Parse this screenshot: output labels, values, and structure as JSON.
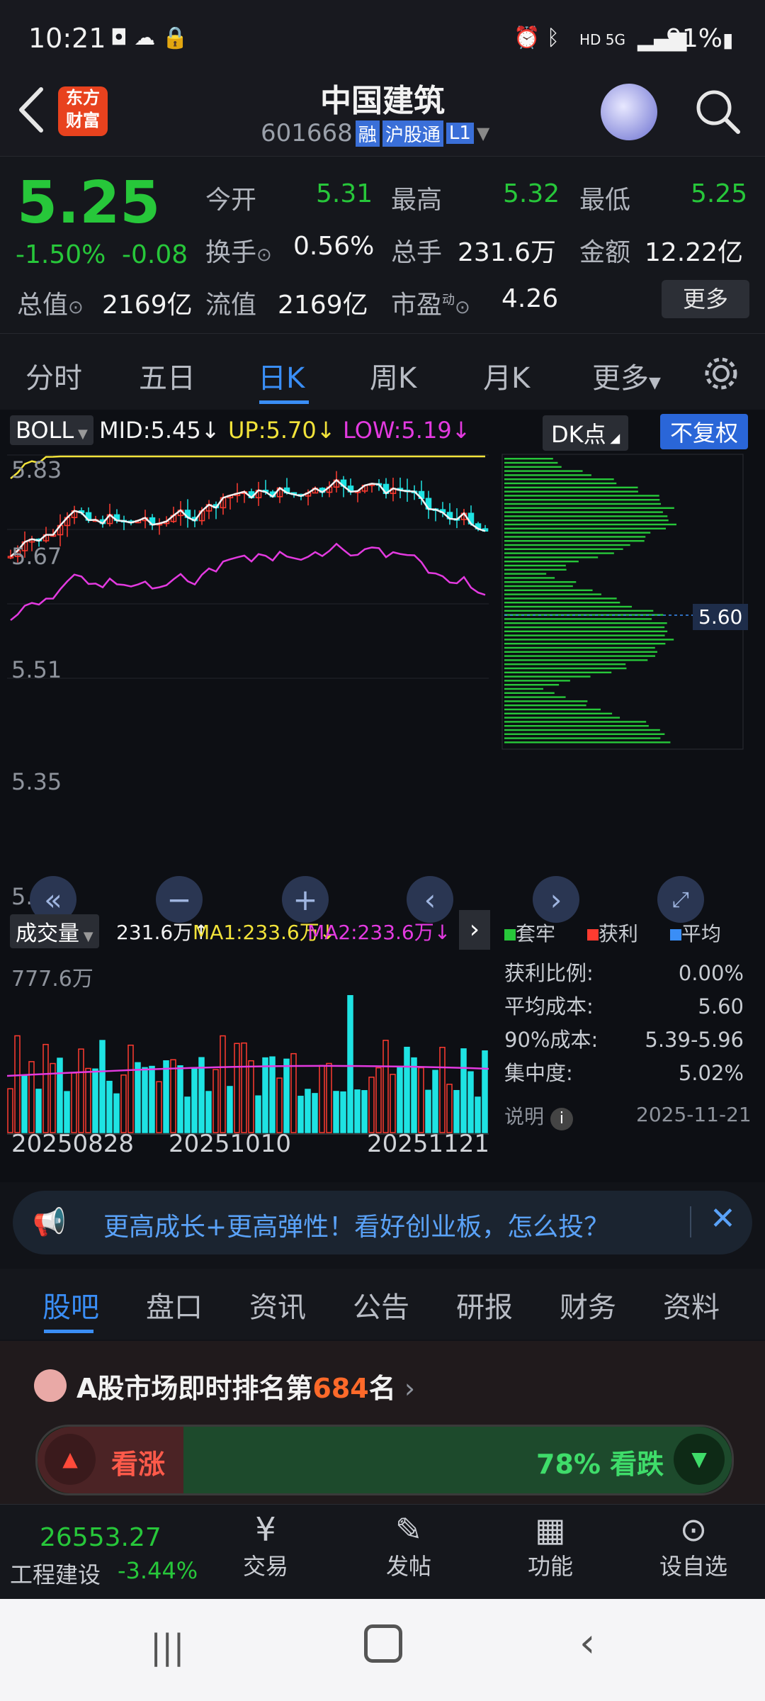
{
  "status": {
    "time": "10:21",
    "battery": "91%",
    "network": "HD 5G"
  },
  "header": {
    "app_logo_line1": "东方",
    "app_logo_line2": "财富",
    "stock_name": "中国建筑",
    "stock_code": "601668",
    "tag_margin": "融",
    "tag_connect": "沪股通",
    "tag_level": "L1"
  },
  "quote": {
    "price": "5.25",
    "change_pct": "-1.50%",
    "change": "-0.08",
    "open_label": "今开",
    "open": "5.31",
    "high_label": "最高",
    "high": "5.32",
    "low_label": "最低",
    "low": "5.25",
    "turnover_label": "换手",
    "turnover": "0.56%",
    "volume_label": "总手",
    "volume": "231.6万",
    "amount_label": "金额",
    "amount": "12.22亿",
    "mcap_label": "总值",
    "mcap": "2169亿",
    "float_label": "流值",
    "float": "2169亿",
    "pe_label": "市盈",
    "pe_sup": "动",
    "pe": "4.26",
    "more": "更多"
  },
  "tabs": [
    "分时",
    "五日",
    "日K",
    "周K",
    "月K",
    "更多"
  ],
  "indicator": {
    "name": "BOLL",
    "mid": "MID:5.45↓",
    "up": "UP:5.70↓",
    "low": "LOW:5.19↓",
    "dk": "DK点",
    "adjust": "不复权"
  },
  "chart_axis": {
    "y1": "5.83",
    "y2": "5.67",
    "y3": "5.51",
    "y4": "5.35",
    "y5": "5.19"
  },
  "volume": {
    "name": "成交量",
    "val": "231.6万↑",
    "ma1": "MA1:233.6万↓",
    "ma2": "MA2:233.6万↓",
    "max": "777.6万"
  },
  "dates": [
    "20250828",
    "20251010",
    "20251121"
  ],
  "chip": {
    "avg_label": "5.60",
    "legend": [
      "套牢",
      "获利",
      "平均"
    ],
    "rows": [
      {
        "k": "获利比例:",
        "v": "0.00%"
      },
      {
        "k": "平均成本:",
        "v": "5.60"
      },
      {
        "k": "90%成本:",
        "v": "5.39-5.96"
      },
      {
        "k": "集中度:",
        "v": "5.02%"
      }
    ],
    "note": "说明",
    "date": "2025-11-21"
  },
  "banner": {
    "text": "更高成长+更高弹性！看好创业板，怎么投？"
  },
  "subtabs": [
    "股吧",
    "盘口",
    "资讯",
    "公告",
    "研报",
    "财务",
    "资料"
  ],
  "rank": {
    "prefix": "A股市场即时排名第",
    "num": "684",
    "suffix": "名"
  },
  "vote": {
    "up": "看涨",
    "down": "78% 看跌"
  },
  "bottom": {
    "index_value": "26553.27",
    "index_name": "工程建设",
    "index_change": "-3.44%",
    "nav": [
      "交易",
      "发帖",
      "功能",
      "设自选"
    ]
  },
  "colors": {
    "up": "#ff3b30",
    "down": "#27c73a",
    "accent": "#3a8ef6",
    "boll_up": "#f2e33a",
    "boll_low": "#e33ae0"
  }
}
